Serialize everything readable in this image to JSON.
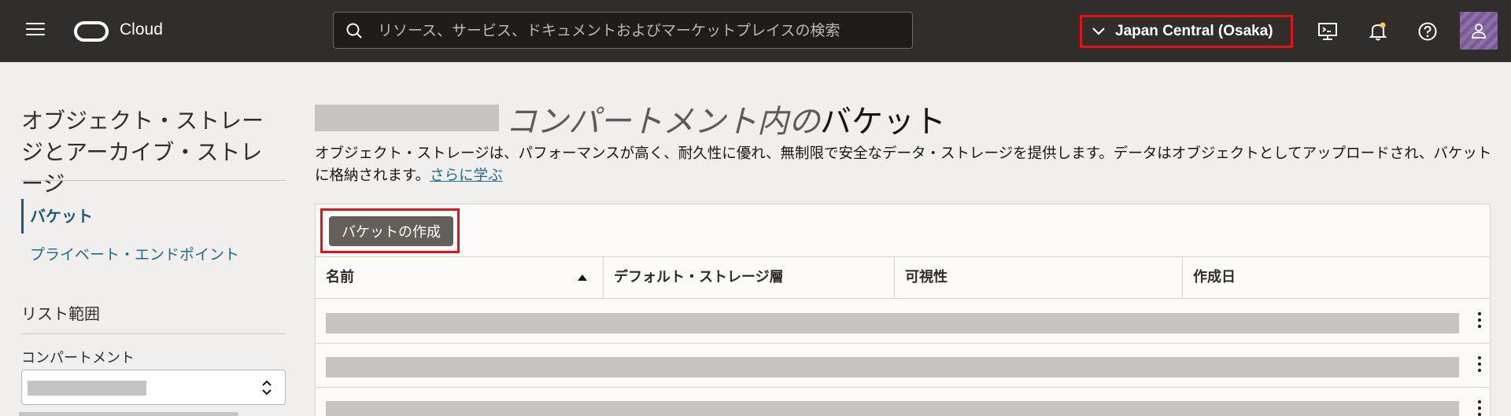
{
  "header": {
    "brand": "Cloud",
    "search_placeholder": "リソース、サービス、ドキュメントおよびマーケットプレイスの検索",
    "region": "Japan Central (Osaka)"
  },
  "sidebar": {
    "title": "オブジェクト・ストレージとアーカイブ・ストレージ",
    "items": [
      {
        "label": "バケット"
      },
      {
        "label": "プライベート・エンドポイント"
      }
    ],
    "scope_heading": "リスト範囲",
    "compartment_label": "コンパートメント"
  },
  "main": {
    "title_italic": "コンパートメント内の",
    "title_rest": "バケット",
    "description": "オブジェクト・ストレージは、パフォーマンスが高く、耐久性に優れ、無制限で安全なデータ・ストレージを提供します。データはオブジェクトとしてアップロードされ、バケットに格納されます。",
    "learn_more": "さらに学ぶ",
    "create_button": "バケットの作成",
    "columns": [
      "名前",
      "デフォルト・ストレージ層",
      "可視性",
      "作成日"
    ],
    "sort": "ascending"
  }
}
